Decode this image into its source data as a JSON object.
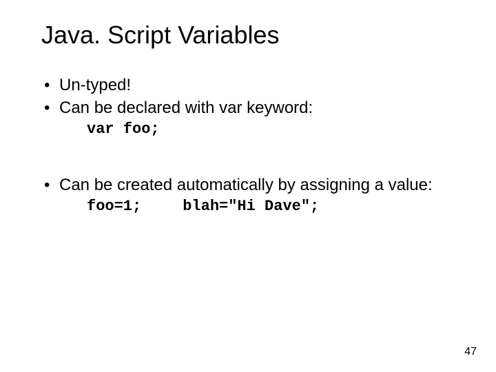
{
  "title": "Java. Script Variables",
  "bullets": {
    "b1": "Un-typed!",
    "b2": "Can be declared with var keyword:",
    "b3": "Can be  created automatically by assigning a value:"
  },
  "code": {
    "c1": "var foo;",
    "c2a": "foo=1;",
    "c2b": "blah=\"Hi Dave\";"
  },
  "page_number": "47"
}
